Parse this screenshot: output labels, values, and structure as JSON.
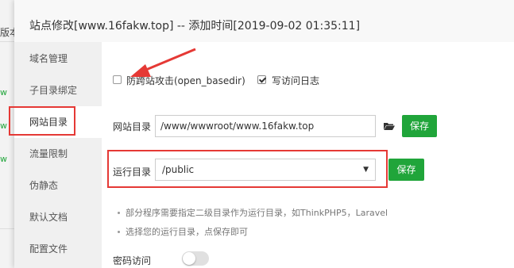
{
  "background": {
    "partial_text": "版本",
    "green_text_1": "w",
    "green_text_2": "w",
    "green_text_3": "w"
  },
  "dialog": {
    "title": "站点修改[www.16fakw.top] -- 添加时间[2019-09-02 01:35:11]"
  },
  "sidebar": {
    "items": [
      {
        "label": "域名管理"
      },
      {
        "label": "子目录绑定"
      },
      {
        "label": "网站目录"
      },
      {
        "label": "流量限制"
      },
      {
        "label": "伪静态"
      },
      {
        "label": "默认文档"
      },
      {
        "label": "配置文件"
      }
    ]
  },
  "options": {
    "anti_xss_label": "防跨站攻击(open_basedir)",
    "anti_xss_checked": false,
    "access_log_label": "写访问日志",
    "access_log_checked": true
  },
  "site_dir": {
    "label": "网站目录",
    "value": "/www/wwwroot/www.16fakw.top",
    "save_label": "保存"
  },
  "run_dir": {
    "label": "运行目录",
    "selected": "/public",
    "save_label": "保存"
  },
  "notes": [
    "部分程序需要指定二级目录作为运行目录，如ThinkPHP5，Laravel",
    "选择您的运行目录，点保存即可"
  ],
  "password_access": {
    "label": "密码访问",
    "enabled": false
  },
  "colors": {
    "accent_green": "#20a53a",
    "highlight_red": "#e53935"
  }
}
